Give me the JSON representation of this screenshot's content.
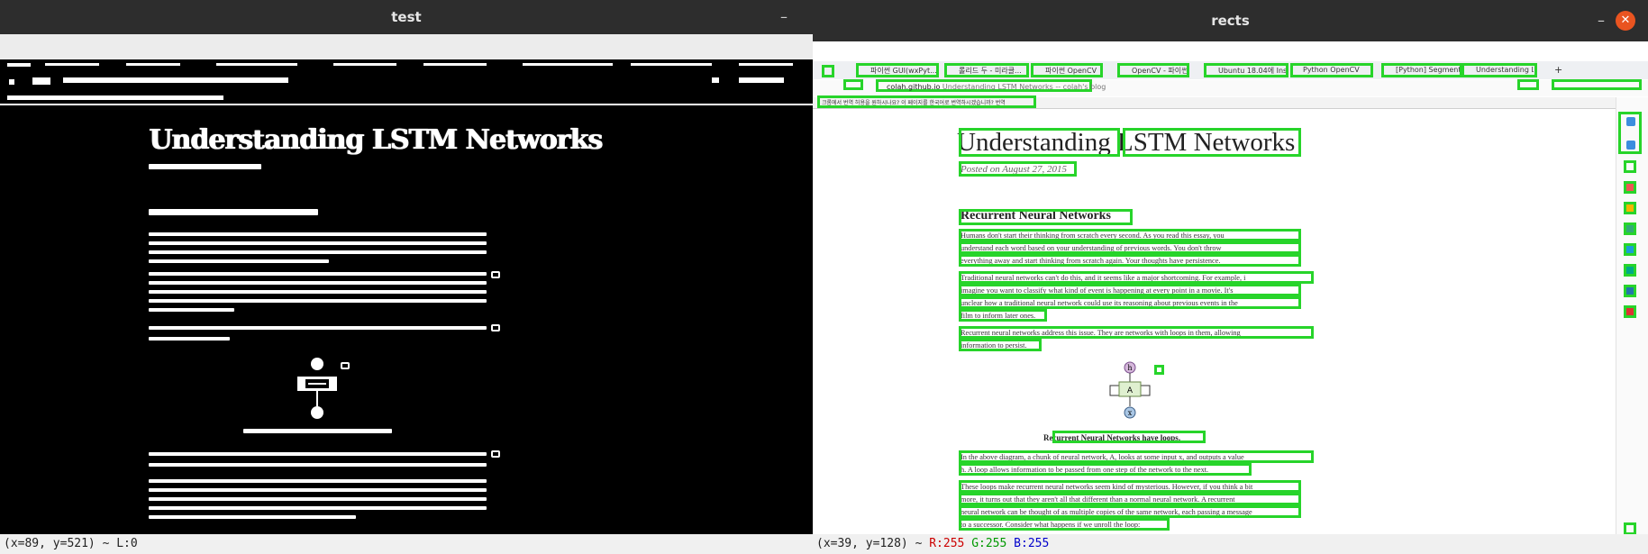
{
  "left_window": {
    "title": "test",
    "minimize_label": "–",
    "status": "(x=89, y=521) ~ L:0"
  },
  "right_window": {
    "title": "rects",
    "minimize_label": "–",
    "close_label": "✕",
    "tabs": [
      {
        "label": "파이썬 GUI(wxPyt..."
      },
      {
        "label": "롤리드 두 - 미라클..."
      },
      {
        "label": "파이썬 OpenCV"
      },
      {
        "label": "OpenCV - 파이썬"
      },
      {
        "label": "Ubuntu 18.04에 Ins..."
      },
      {
        "label": "Python OpenCV"
      },
      {
        "label": "[Python] Segment..."
      },
      {
        "label": "Understanding L..."
      }
    ],
    "new_tab_label": "+",
    "address": {
      "domain": "colah.github.io",
      "path": " Understanding LSTM Networks -- colah's blog"
    },
    "info_bar": "크롬에서 번역 허용을 원하시나요? 이 페이지를 한국어로 번역하시겠습니까? 번역",
    "article": {
      "title": "Understanding LSTM Networks",
      "date": "Posted on August 27, 2015",
      "heading": "Recurrent Neural Networks",
      "paragraphs": [
        [
          "Humans don't start their thinking from scratch every second. As you read this essay, you",
          "understand each word based on your understanding of previous words. You don't throw",
          "everything away and start thinking from scratch again. Your thoughts have persistence."
        ],
        [
          "Traditional neural networks can't do this, and it seems like a major shortcoming. For example, i",
          "imagine you want to classify what kind of event is happening at every point in a movie. It's",
          "unclear how a traditional neural network could use its reasoning about previous events in the",
          "film to inform later ones."
        ],
        [
          "Recurrent neural networks address this issue. They are networks with loops in them, allowing",
          "information to persist."
        ],
        [
          "In the above diagram, a chunk of neural network, A, looks at some input x, and outputs a value",
          "h. A loop allows information to be passed from one step of the network to the next."
        ],
        [
          "These loops make recurrent neural networks seem kind of mysterious. However, if you think a bit",
          "more, it turns out that they aren't all that different than a normal neural network. A recurrent",
          "neural network can be thought of as multiple copies of the same network, each passing a message",
          "to a successor. Consider what happens if we unroll the loop:"
        ]
      ],
      "diagram": {
        "output_label": "h",
        "cell_label": "A",
        "input_label": "x"
      },
      "caption": "Recurrent Neural Networks have loops."
    },
    "status": {
      "coords": "(x=39, y=128) ~ ",
      "r": "R:255",
      "g": "G:255",
      "b": "B:255"
    },
    "accent": "#27d42a"
  }
}
